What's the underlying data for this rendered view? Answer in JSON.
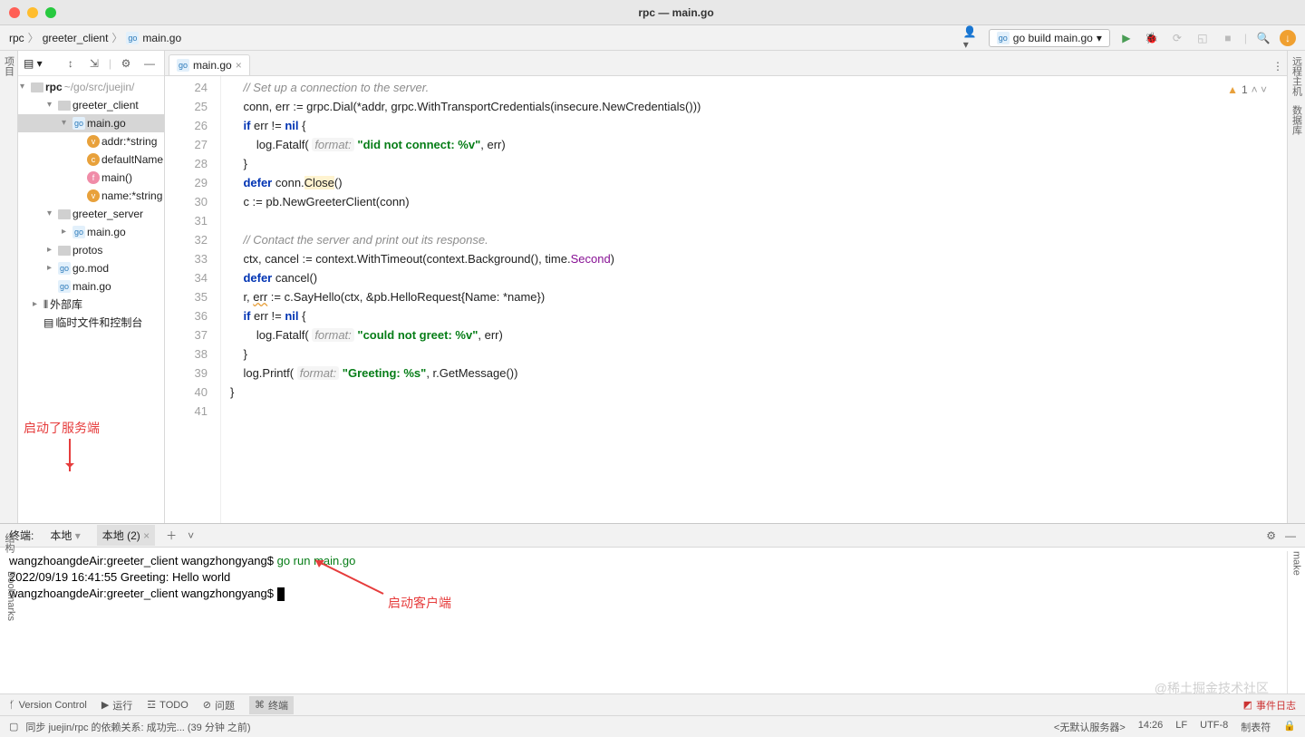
{
  "window": {
    "title": "rpc — main.go"
  },
  "breadcrumb": [
    "rpc",
    "greeter_client",
    "main.go"
  ],
  "run_config": "go build main.go",
  "tree": {
    "root": {
      "name": "rpc",
      "path": "~/go/src/juejin/"
    },
    "items": [
      {
        "lvl": 1,
        "exp": "▾",
        "icon": "folder",
        "label": "greeter_client"
      },
      {
        "lvl": 2,
        "exp": "▾",
        "icon": "go",
        "label": "main.go",
        "sel": true
      },
      {
        "lvl": 3,
        "icon": "v",
        "label": "addr:*string"
      },
      {
        "lvl": 3,
        "icon": "c",
        "label": "defaultName"
      },
      {
        "lvl": 3,
        "icon": "f",
        "label": "main()"
      },
      {
        "lvl": 3,
        "icon": "v",
        "label": "name:*string"
      },
      {
        "lvl": 1,
        "exp": "▾",
        "icon": "folder",
        "label": "greeter_server"
      },
      {
        "lvl": 2,
        "exp": "▸",
        "icon": "go",
        "label": "main.go"
      },
      {
        "lvl": 1,
        "exp": "▸",
        "icon": "folder",
        "label": "protos"
      },
      {
        "lvl": 1,
        "exp": "▸",
        "icon": "go",
        "label": "go.mod"
      },
      {
        "lvl": 1,
        "icon": "go",
        "label": "main.go"
      },
      {
        "lvl": 0,
        "exp": "▸",
        "icon": "lib",
        "label": "外部库"
      },
      {
        "lvl": 0,
        "icon": "console",
        "label": "临时文件和控制台"
      }
    ]
  },
  "editor": {
    "tab": "main.go",
    "lines": [
      {
        "n": 24,
        "seg": [
          {
            "t": "    ",
            "c": ""
          },
          {
            "t": "// Set up a connection to the server.",
            "c": "cmt"
          }
        ]
      },
      {
        "n": 25,
        "seg": [
          {
            "t": "    conn, err := grpc.Dial(*addr, grpc.WithTransportCredentials(insecure.NewCredentials()))",
            "c": ""
          }
        ]
      },
      {
        "n": 26,
        "seg": [
          {
            "t": "    ",
            "c": ""
          },
          {
            "t": "if",
            "c": "kw"
          },
          {
            "t": " err != ",
            "c": ""
          },
          {
            "t": "nil",
            "c": "kw"
          },
          {
            "t": " {",
            "c": ""
          }
        ]
      },
      {
        "n": 27,
        "seg": [
          {
            "t": "        log.Fatalf( ",
            "c": ""
          },
          {
            "t": "format:",
            "c": "hint"
          },
          {
            "t": " ",
            "c": ""
          },
          {
            "t": "\"did not connect: %v\"",
            "c": "str"
          },
          {
            "t": ", err)",
            "c": ""
          }
        ]
      },
      {
        "n": 28,
        "seg": [
          {
            "t": "    }",
            "c": ""
          }
        ]
      },
      {
        "n": 29,
        "seg": [
          {
            "t": "    ",
            "c": ""
          },
          {
            "t": "defer",
            "c": "kw"
          },
          {
            "t": " conn.",
            "c": ""
          },
          {
            "t": "Close",
            "c": "hl"
          },
          {
            "t": "()",
            "c": ""
          }
        ]
      },
      {
        "n": 30,
        "seg": [
          {
            "t": "    c := pb.NewGreeterClient(conn)",
            "c": ""
          }
        ]
      },
      {
        "n": 31,
        "seg": [
          {
            "t": "",
            "c": ""
          }
        ]
      },
      {
        "n": 32,
        "seg": [
          {
            "t": "    ",
            "c": ""
          },
          {
            "t": "// Contact the server and print out its response.",
            "c": "cmt"
          }
        ]
      },
      {
        "n": 33,
        "seg": [
          {
            "t": "    ctx, cancel := context.WithTimeout(context.Background(), time.",
            "c": ""
          },
          {
            "t": "Second",
            "c": "pl"
          },
          {
            "t": ")",
            "c": ""
          }
        ]
      },
      {
        "n": 34,
        "seg": [
          {
            "t": "    ",
            "c": ""
          },
          {
            "t": "defer",
            "c": "kw"
          },
          {
            "t": " cancel()",
            "c": ""
          }
        ]
      },
      {
        "n": 35,
        "seg": [
          {
            "t": "    r, ",
            "c": ""
          },
          {
            "t": "err",
            "c": "warn"
          },
          {
            "t": " := c.SayHello(ctx, &pb.HelloRequest{Name: *name})",
            "c": ""
          }
        ]
      },
      {
        "n": 36,
        "seg": [
          {
            "t": "    ",
            "c": ""
          },
          {
            "t": "if",
            "c": "kw"
          },
          {
            "t": " err != ",
            "c": ""
          },
          {
            "t": "nil",
            "c": "kw"
          },
          {
            "t": " {",
            "c": ""
          }
        ]
      },
      {
        "n": 37,
        "seg": [
          {
            "t": "        log.Fatalf( ",
            "c": ""
          },
          {
            "t": "format:",
            "c": "hint"
          },
          {
            "t": " ",
            "c": ""
          },
          {
            "t": "\"could not greet: %v\"",
            "c": "str"
          },
          {
            "t": ", err)",
            "c": ""
          }
        ]
      },
      {
        "n": 38,
        "seg": [
          {
            "t": "    }",
            "c": ""
          }
        ]
      },
      {
        "n": 39,
        "seg": [
          {
            "t": "    log.Printf( ",
            "c": ""
          },
          {
            "t": "format:",
            "c": "hint"
          },
          {
            "t": " ",
            "c": ""
          },
          {
            "t": "\"Greeting: %s\"",
            "c": "str"
          },
          {
            "t": ", r.GetMessage())",
            "c": ""
          }
        ]
      },
      {
        "n": 40,
        "seg": [
          {
            "t": "}",
            "c": ""
          }
        ]
      },
      {
        "n": 41,
        "seg": [
          {
            "t": "",
            "c": ""
          }
        ]
      }
    ],
    "warn_count": "1"
  },
  "annotations": {
    "server": "启动了服务端",
    "client": "启动客户端"
  },
  "terminal": {
    "title": "终端:",
    "tabs": [
      "本地",
      "本地 (2)"
    ],
    "lines": [
      {
        "prompt": "wangzhoangdeAir:greeter_client wangzhongyang$ ",
        "cmd": "go run main.go"
      },
      {
        "text": "2022/09/19 16:41:55 Greeting: Hello world"
      },
      {
        "prompt": "wangzhoangdeAir:greeter_client wangzhongyang$ ",
        "cursor": true
      }
    ]
  },
  "left_tabs": {
    "project": "项目",
    "structure": "结构",
    "bookmarks": "Bookmarks"
  },
  "right_tabs": {
    "remote": "远程主机",
    "db": "数据库",
    "make": "make"
  },
  "bottom_tools": {
    "vc": "Version Control",
    "run": "运行",
    "todo": "TODO",
    "problems": "问题",
    "terminal": "终端"
  },
  "status": {
    "msg": "同步 juejin/rpc 的依赖关系: 成功完... (39 分钟 之前)",
    "server": "<无默认服务器>",
    "pos": "14:26",
    "le": "LF",
    "enc": "UTF-8",
    "tab": "制表符",
    "log": "事件日志"
  },
  "watermark": "@稀土掘金技术社区"
}
